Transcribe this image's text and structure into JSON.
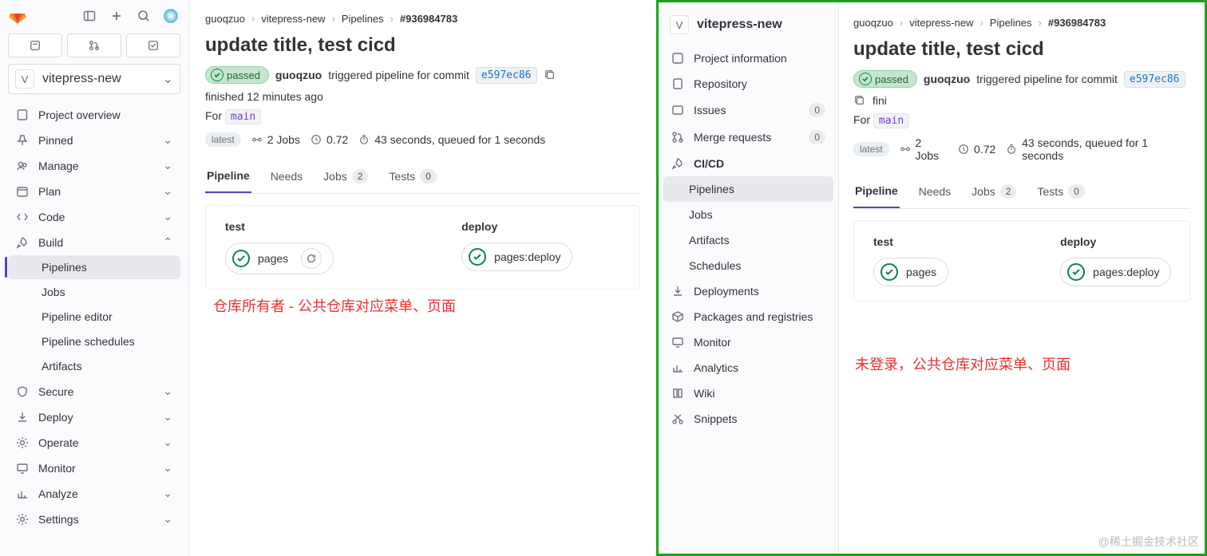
{
  "left": {
    "project": {
      "avatar_letter": "V",
      "name": "vitepress-new"
    },
    "nav": {
      "project_overview": "Project overview",
      "pinned": "Pinned",
      "manage": "Manage",
      "plan": "Plan",
      "code": "Code",
      "build": "Build",
      "build_children": {
        "pipelines": "Pipelines",
        "jobs": "Jobs",
        "pipeline_editor": "Pipeline editor",
        "pipeline_schedules": "Pipeline schedules",
        "artifacts": "Artifacts"
      },
      "secure": "Secure",
      "deploy": "Deploy",
      "operate": "Operate",
      "monitor": "Monitor",
      "analyze": "Analyze",
      "settings": "Settings"
    },
    "breadcrumb": {
      "a": "guoqzuo",
      "b": "vitepress-new",
      "c": "Pipelines",
      "d": "#936984783"
    },
    "title": "update title, test cicd",
    "status_label": "passed",
    "author": "guoqzuo",
    "triggered_text": "triggered pipeline for commit",
    "commit_sha": "e597ec86",
    "finished_text": "finished 12 minutes ago",
    "for_label": "For",
    "for_branch": "main",
    "latest_label": "latest",
    "jobs_count": "2 Jobs",
    "coverage": "0.72",
    "duration_text": "43 seconds, queued for 1 seconds",
    "tabs": {
      "pipeline": "Pipeline",
      "needs": "Needs",
      "jobs": "Jobs",
      "jobs_n": "2",
      "tests": "Tests",
      "tests_n": "0"
    },
    "stage_test": "test",
    "stage_deploy": "deploy",
    "job_pages": "pages",
    "job_deploy": "pages:deploy",
    "annotation": "仓库所有者 - 公共仓库对应菜单、页面"
  },
  "right": {
    "project": {
      "avatar_letter": "V",
      "name": "vitepress-new"
    },
    "nav": {
      "project_information": "Project information",
      "repository": "Repository",
      "issues": "Issues",
      "issues_n": "0",
      "merge_requests": "Merge requests",
      "mr_n": "0",
      "cicd": "CI/CD",
      "cicd_children": {
        "pipelines": "Pipelines",
        "jobs": "Jobs",
        "artifacts": "Artifacts",
        "schedules": "Schedules"
      },
      "deployments": "Deployments",
      "packages": "Packages and registries",
      "monitor": "Monitor",
      "analytics": "Analytics",
      "wiki": "Wiki",
      "snippets": "Snippets"
    },
    "breadcrumb": {
      "a": "guoqzuo",
      "b": "vitepress-new",
      "c": "Pipelines",
      "d": "#936984783"
    },
    "title": "update title, test cicd",
    "status_label": "passed",
    "author": "guoqzuo",
    "triggered_text": "triggered pipeline for commit",
    "commit_sha": "e597ec86",
    "finished_text_partial": "fini",
    "for_label": "For",
    "for_branch": "main",
    "latest_label": "latest",
    "jobs_count": "2 Jobs",
    "coverage": "0.72",
    "duration_text": "43 seconds, queued for 1 seconds",
    "tabs": {
      "pipeline": "Pipeline",
      "needs": "Needs",
      "jobs": "Jobs",
      "jobs_n": "2",
      "tests": "Tests",
      "tests_n": "0"
    },
    "stage_test": "test",
    "stage_deploy": "deploy",
    "job_pages": "pages",
    "job_deploy": "pages:deploy",
    "annotation": "未登录，公共仓库对应菜单、页面"
  },
  "watermark": "@稀土掘金技术社区"
}
